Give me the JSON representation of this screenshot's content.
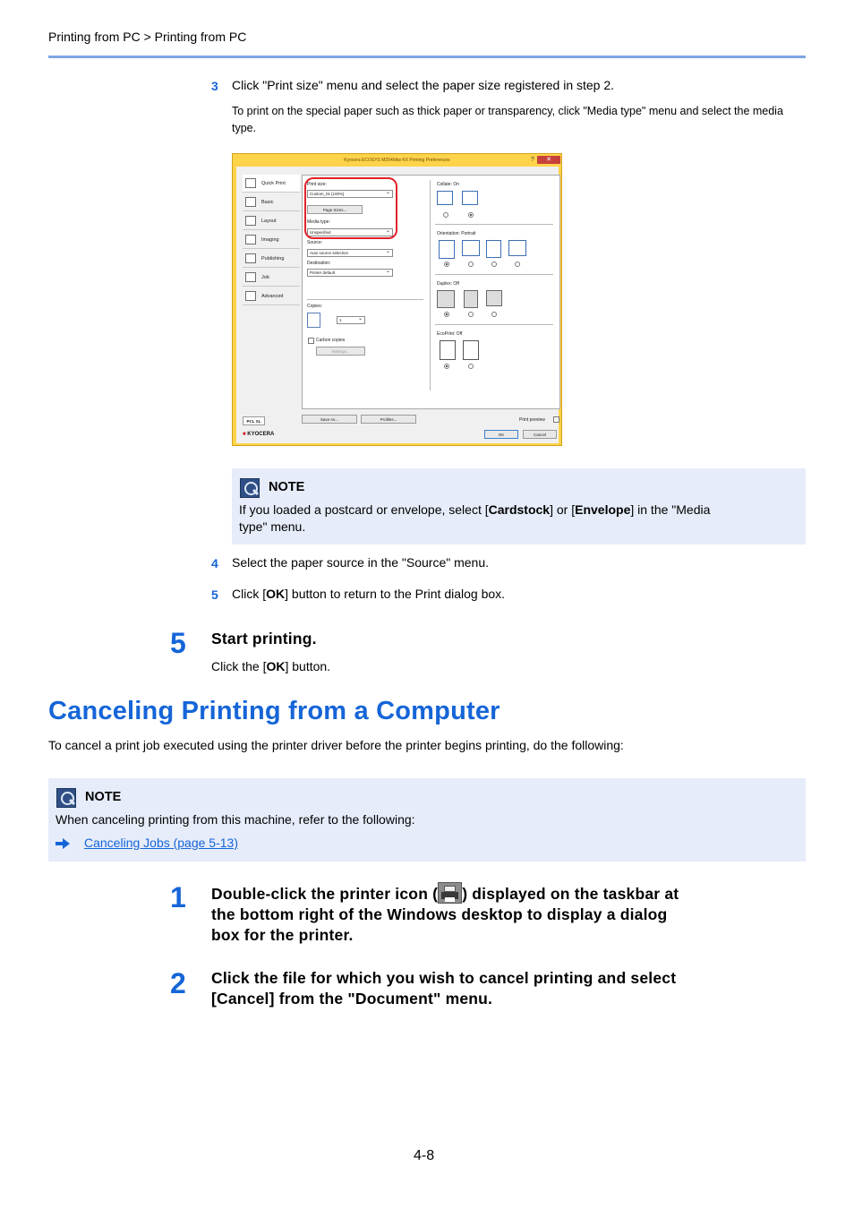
{
  "header": {
    "breadcrumb": "Printing from PC > Printing from PC"
  },
  "substep3": {
    "num": "3",
    "text": "Click \"Print size\" menu and select the paper size registered in step 2.",
    "subtext": "To print on the special paper such as thick paper or transparency, click \"Media type\" menu and select the media type."
  },
  "dialog": {
    "title": "Kyocera ECOSYS M2540dw KX Printing Preferences",
    "help": "?",
    "close": "✕",
    "tabs": [
      "Quick Print",
      "Basic",
      "Layout",
      "Imaging",
      "Publishing",
      "Job",
      "Advanced"
    ],
    "print_size_label": "Print size:",
    "print_size_value": "Custom_01 [100%]",
    "page_sizes_button": "Page Sizes...",
    "media_type_label": "Media type:",
    "media_type_value": "Unspecified",
    "source_label": "Source:",
    "source_value": "Auto source selection",
    "destination_label": "Destination:",
    "destination_value": "Printer default",
    "copies_label": "Copies:",
    "copies_value": "1",
    "carbon_copies_label": "Carbon copies",
    "settings_button": "Settings...",
    "collate_label": "Collate:  On",
    "orientation_label": "Orientation:  Portrait",
    "duplex_label": "Duplex:  Off",
    "ecoprint_label": "EcoPrint:  Off",
    "pcl_badge": "PCL XL",
    "save_as_button": "Save As...",
    "profiles_button": "Profiles...",
    "print_preview_label": "Print preview",
    "brand": "KYOCERA",
    "ok_button": "OK",
    "cancel_button": "Cancel"
  },
  "note1": {
    "title": "NOTE",
    "text_before": "If you loaded a postcard or envelope, select [",
    "cardstock": "Cardstock",
    "text_mid": "] or [",
    "envelope": "Envelope",
    "text_after": "] in the \"Media",
    "text_line2": "type\" menu."
  },
  "substep4": {
    "num": "4",
    "text": "Select the paper source in the \"Source\" menu."
  },
  "substep5": {
    "num": "5",
    "text_before": "Click [",
    "bold": "OK",
    "text_after": "] button to return to the Print dialog box."
  },
  "step5": {
    "num": "5",
    "title": "Start printing.",
    "text_before": "Click the [",
    "bold": "OK",
    "text_after": "] button."
  },
  "section": {
    "title": "Canceling Printing from a Computer",
    "intro": "To cancel a print job executed using the printer driver before the printer begins printing, do the following:"
  },
  "note2": {
    "title": "NOTE",
    "text": "When canceling printing from this machine, refer to the following:",
    "link": "Canceling Jobs (page 5-13)"
  },
  "step1": {
    "num": "1",
    "line1_before": "Double-click the printer icon (",
    "line1_after": ") displayed on the taskbar at",
    "line2": "the bottom right of the Windows desktop to display a dialog",
    "line3": "box for the printer."
  },
  "step2": {
    "num": "2",
    "line1": "Click the file for which you wish to cancel printing and select",
    "line2": "[Cancel] from the \"Document\" menu."
  },
  "footer": {
    "page": "4-8"
  },
  "colors": {
    "accent": "#1565d8",
    "note_bg": "#e6ecf9",
    "rule": "#7fa6e3",
    "highlight_ring": "#e2212b"
  }
}
